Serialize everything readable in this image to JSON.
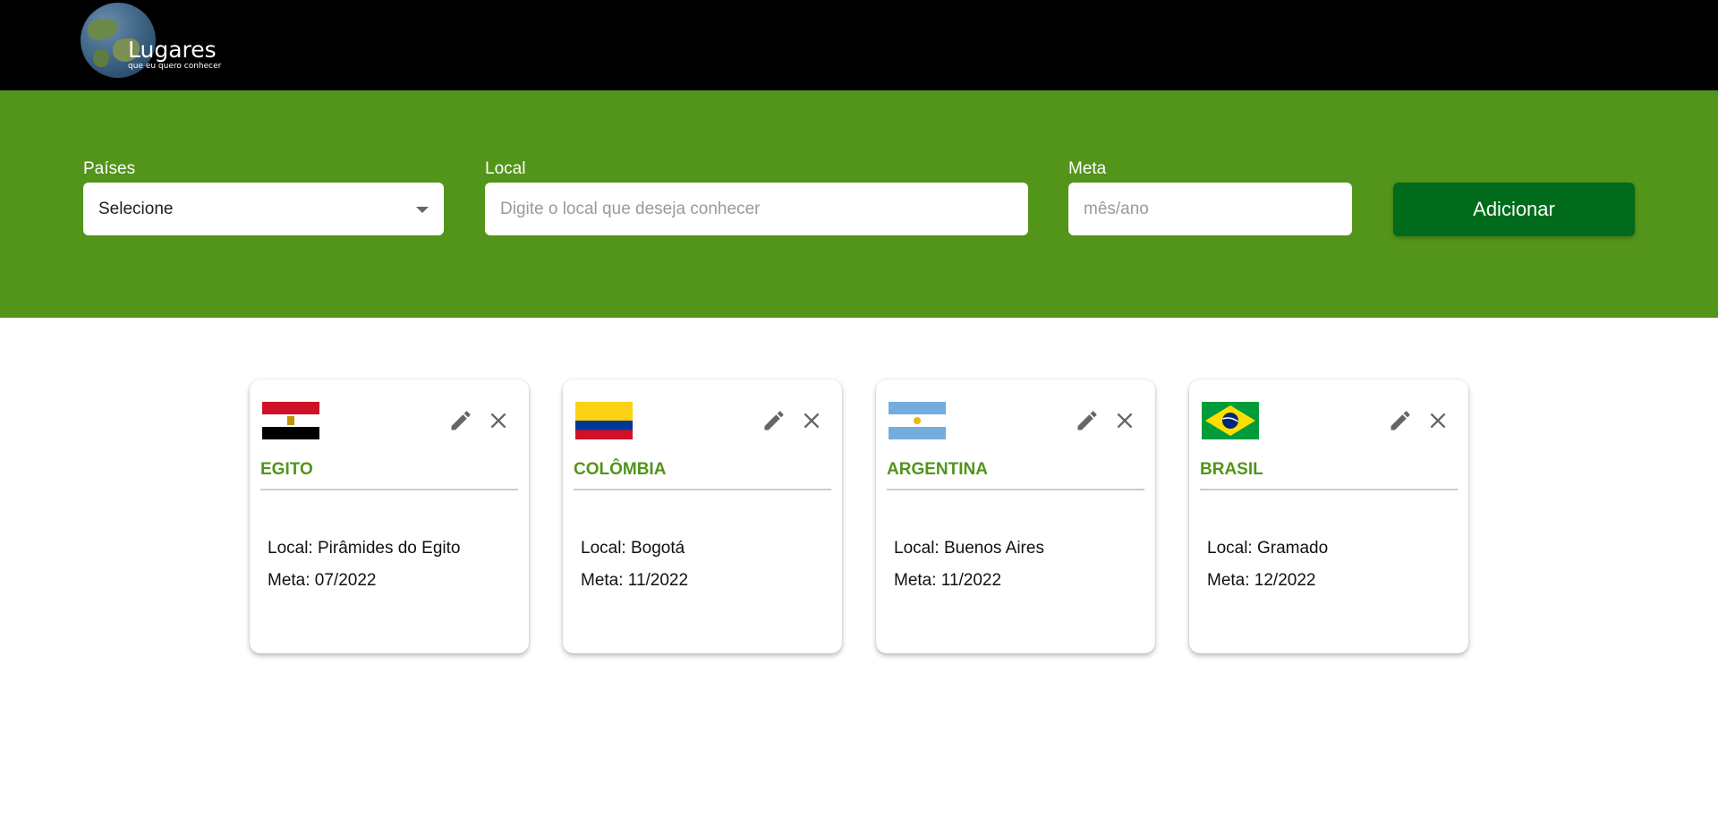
{
  "header": {
    "logo_title": "Lugares",
    "logo_subtitle": "que eu quero conhecer"
  },
  "form": {
    "countries_label": "Países",
    "countries_value": "Selecione",
    "local_label": "Local",
    "local_placeholder": "Digite o local que deseja conhecer",
    "goal_label": "Meta",
    "goal_placeholder": "mês/ano",
    "add_button": "Adicionar"
  },
  "cards": [
    {
      "country": "EGITO",
      "local": "Local: Pirâmides do Egito",
      "meta": "Meta: 07/2022",
      "flag": "egypt-flag"
    },
    {
      "country": "COLÔMBIA",
      "local": "Local: Bogotá",
      "meta": "Meta: 11/2022",
      "flag": "colombia-flag"
    },
    {
      "country": "ARGENTINA",
      "local": "Local: Buenos Aires",
      "meta": "Meta: 11/2022",
      "flag": "argentina-flag"
    },
    {
      "country": "BRASIL",
      "local": "Local: Gramado",
      "meta": "Meta: 12/2022",
      "flag": "brazil-flag"
    }
  ],
  "colors": {
    "header_bg": "#000000",
    "form_bg": "#53941b",
    "button_bg": "#006b1a",
    "country_text": "#53941b"
  },
  "icons": [
    "pencil-icon",
    "close-icon",
    "dropdown-arrow-icon",
    "globe-logo"
  ]
}
